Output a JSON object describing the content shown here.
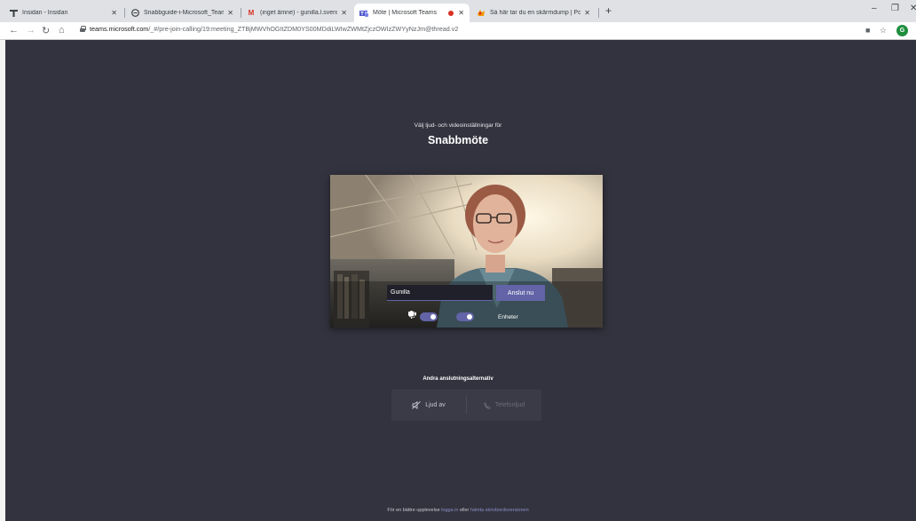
{
  "browser": {
    "tabs": [
      {
        "favicon": "teams-insidan-icon",
        "title": "Insidan - Insidan"
      },
      {
        "favicon": "globe-icon",
        "title": "Snabbguide-i-Microsoft_Teams.p"
      },
      {
        "favicon": "gmail-icon",
        "title": "(inget ämne) - gunilla.l.svensson"
      },
      {
        "favicon": "teams-icon",
        "title": "Möte | Microsoft Teams"
      },
      {
        "favicon": "pc-icon",
        "title": "Så här tar du en skärmdump | Pc"
      }
    ],
    "url_host": "teams.microsoft.com",
    "url_path": "/_#/pre-join-calling/19:meeting_ZTBjMWVhOGItZDM0YS00MDdiLWIwZWMtZjczOWIzZWYyNzJm@thread.v2",
    "profile_initial": "G"
  },
  "prejoin": {
    "subtitle": "Välj ljud- och videoinställningar för",
    "meeting_title": "Snabbmöte",
    "name_value": "Gunilla",
    "join_label": "Anslut nu",
    "devices_label": "Enheter",
    "camera_on": true,
    "mic_on": true
  },
  "other_options": {
    "title": "Andra anslutningsalternativ",
    "audio_off_label": "Ljud av",
    "phone_audio_label": "Telefonljud"
  },
  "footer": {
    "prefix": "För en bättre upplevelse",
    "login_link": "logga in",
    "middle": "eller",
    "download_link": "hämta skrivbordsversionen"
  },
  "colors": {
    "accent": "#6264a7",
    "background": "#33333f"
  }
}
